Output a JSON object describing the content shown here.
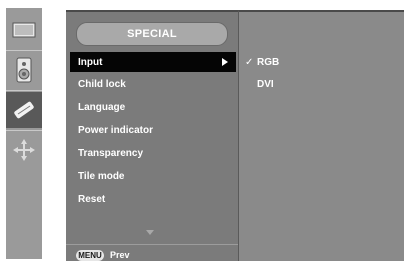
{
  "icons": [
    {
      "name": "picture-icon"
    },
    {
      "name": "sound-icon"
    },
    {
      "name": "special-icon"
    },
    {
      "name": "screen-position-icon"
    }
  ],
  "menu": {
    "title": "SPECIAL",
    "items": [
      {
        "label": "Input",
        "selected": true,
        "has_submenu": true
      },
      {
        "label": "Child lock"
      },
      {
        "label": "Language"
      },
      {
        "label": "Power indicator"
      },
      {
        "label": "Transparency"
      },
      {
        "label": "Tile mode"
      },
      {
        "label": "Reset"
      }
    ],
    "footer": {
      "key_label": "MENU",
      "action_label": "Prev"
    }
  },
  "submenu": {
    "items": [
      {
        "label": "RGB",
        "check_mark": "✓",
        "checked": true
      },
      {
        "label": "DVI",
        "check_mark": "",
        "checked": false
      }
    ]
  }
}
